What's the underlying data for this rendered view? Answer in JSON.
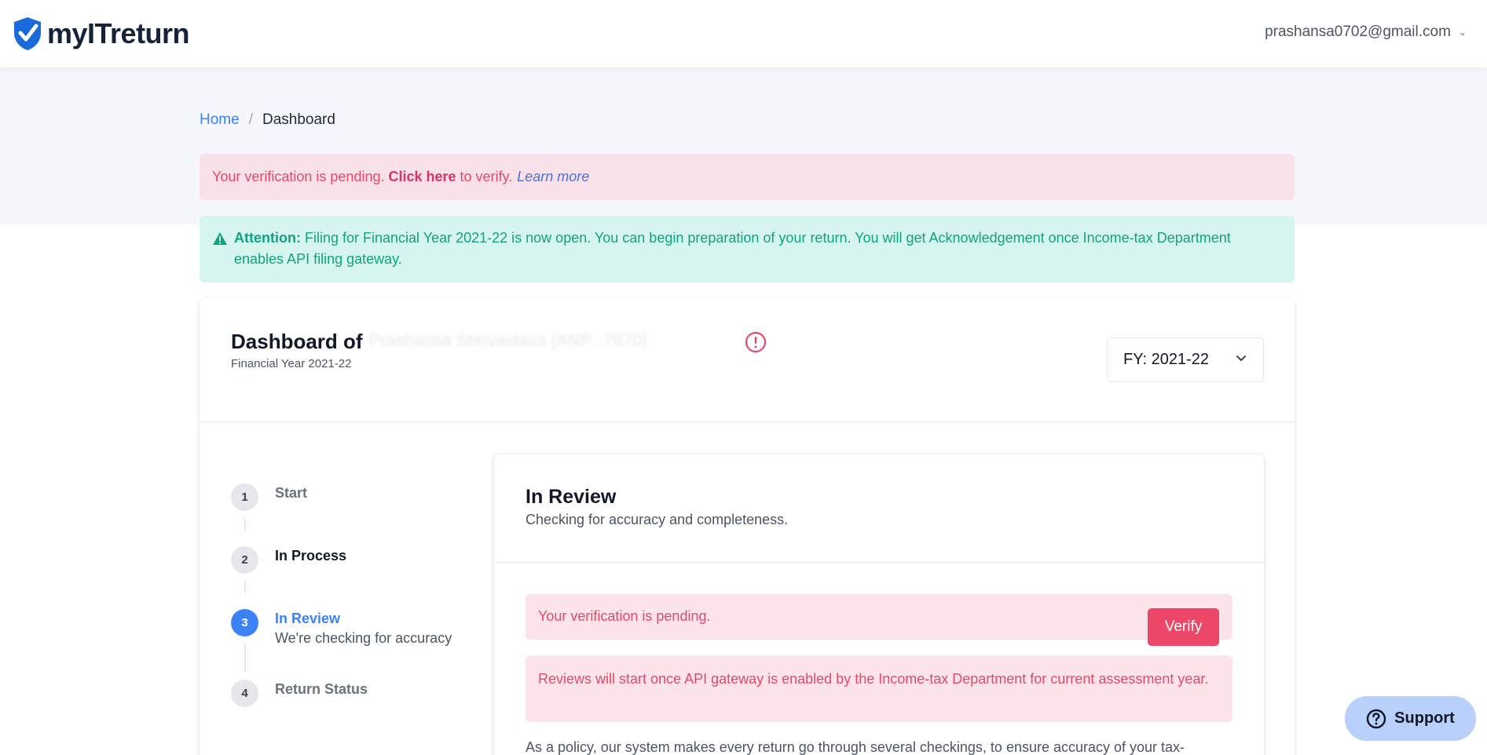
{
  "header": {
    "logo_text": "myITreturn",
    "user_email": "prashansa0702@gmail.com"
  },
  "breadcrumb": {
    "home": "Home",
    "current": "Dashboard"
  },
  "verification_alert": {
    "text_before": "Your verification is pending.",
    "link": "Click here",
    "text_after": "to verify.",
    "learn_more": "Learn more"
  },
  "attention_alert": {
    "label": "Attention:",
    "text": "Filing for Financial Year 2021-22 is now open. You can begin preparation of your return. You will get Acknowledgement once Income-tax Department enables API filing gateway."
  },
  "dashboard": {
    "title": "Dashboard of",
    "redacted_name": "Prashansa Shrivastava [ANP...7670]",
    "subtitle": "Financial Year 2021-22",
    "fy_selector": "FY: 2021-22"
  },
  "steps": [
    {
      "number": "1",
      "label": "Start",
      "desc": ""
    },
    {
      "number": "2",
      "label": "In Process",
      "desc": ""
    },
    {
      "number": "3",
      "label": "In Review",
      "desc": "We're checking for accuracy"
    },
    {
      "number": "4",
      "label": "Return Status",
      "desc": ""
    }
  ],
  "review": {
    "title": "In Review",
    "subtitle": "Checking for accuracy and completeness.",
    "pending_text": "Your verification is pending.",
    "verify_button": "Verify",
    "api_notice": "Reviews will start once API gateway is enabled by the Income-tax Department for current assessment year.",
    "policy_text": "As a policy, our system makes every return go through several checkings, to ensure accuracy of your tax-"
  },
  "support": {
    "label": "Support"
  },
  "colors": {
    "brand_blue": "#1a6ad9",
    "accent_blue": "#3b82f6",
    "pink_alert_bg": "#f9e1ea",
    "pink_text": "#e5486d",
    "green_alert_bg": "#d6f5ee",
    "green_text": "#11a37f",
    "verify_button": "#ec4669"
  },
  "icons": {
    "logo": "shield-check-icon",
    "user_dropdown": "chevron-down-icon",
    "attention": "warning-triangle-icon",
    "error": "exclamation-circle-icon",
    "fy_dropdown": "chevron-down-icon",
    "support": "question-circle-icon"
  }
}
